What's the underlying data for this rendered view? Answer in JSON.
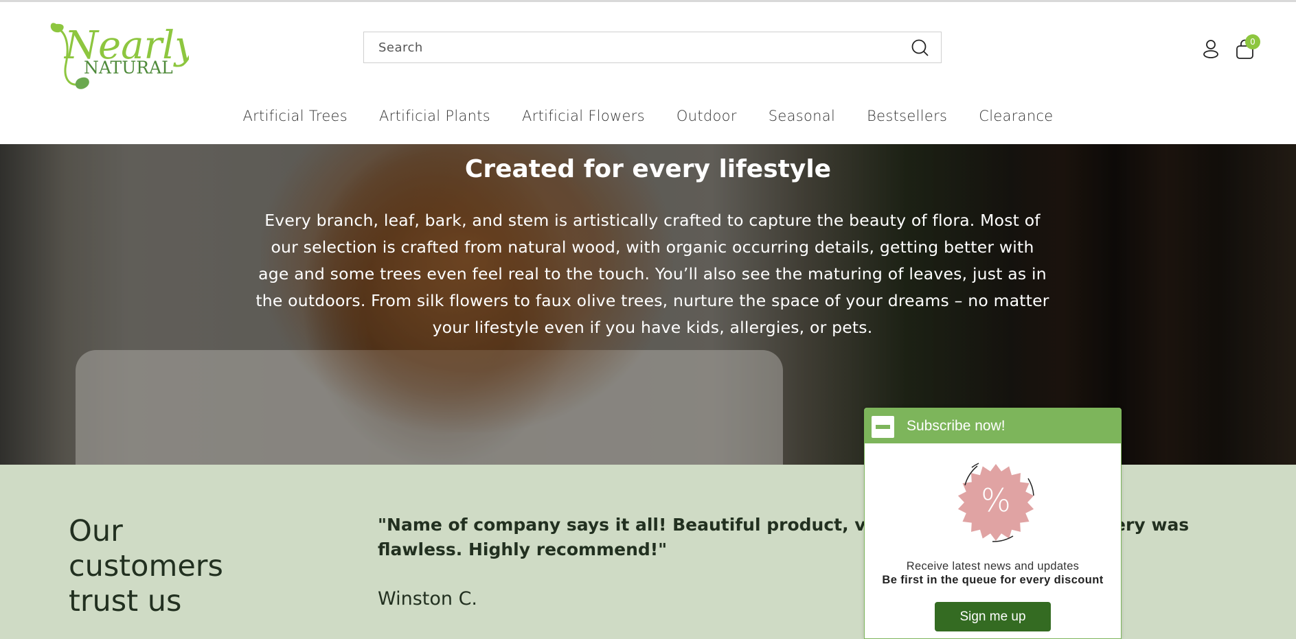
{
  "brand": {
    "logo_script": "Nearly",
    "logo_caps": "NATURAL",
    "accent_color": "#8dc63f",
    "logo_dark_color": "#4e8a3a"
  },
  "header": {
    "search": {
      "placeholder": "Search",
      "value": ""
    },
    "icons": {
      "search": "search-icon",
      "account": "user-icon",
      "cart": "shopping-bag-icon"
    },
    "cart_count": "0"
  },
  "nav": {
    "items": [
      {
        "label": "Artificial Trees"
      },
      {
        "label": "Artificial Plants"
      },
      {
        "label": "Artificial Flowers"
      },
      {
        "label": "Outdoor"
      },
      {
        "label": "Seasonal"
      },
      {
        "label": "Bestsellers"
      },
      {
        "label": "Clearance"
      }
    ]
  },
  "hero": {
    "title": "Created for every lifestyle",
    "body": "Every branch, leaf, bark, and stem is artistically crafted to capture the beauty of flora. Most of our selection is crafted from natural wood, with organic occurring details, getting better with age and some trees even feel real to the touch. You’ll also see the maturing of leaves, just as in the outdoors. From silk flowers to faux olive trees, nurture the space of your dreams – no matter your lifestyle even if you have kids, allergies, or pets."
  },
  "testimonials": {
    "heading": "Our customers trust us",
    "quote": "\"Name of company says it all! Beautiful product, very realistic and the delivery was flawless. Highly recommend!\"",
    "author": "Winston C.",
    "background_color": "#cfdbc5"
  },
  "subscribe_popup": {
    "title": "Subscribe now!",
    "badge_symbol": "%",
    "line1": "Receive latest news and updates",
    "line2": "Be first in the queue for every discount",
    "button_label": "Sign me up",
    "header_color": "#7db55b",
    "button_color": "#346b22",
    "badge_color": "#e0a3a3"
  }
}
